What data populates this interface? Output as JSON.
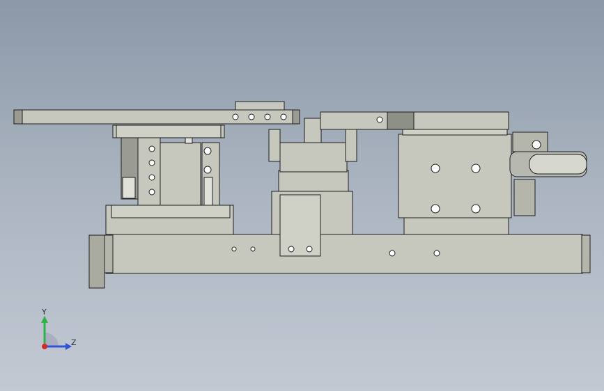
{
  "viewport": {
    "background_top": "#8b98a8",
    "background_bottom": "#c3c9d3",
    "part_fill": "#c7c8bd",
    "part_dark": "#8c8f86",
    "edge_color": "#1e1e1e"
  },
  "triad": {
    "y_label": "Y",
    "z_label": "Z",
    "y_color": "#2db34a",
    "z_color": "#2f55d6",
    "x_color": "#d62a2a"
  }
}
